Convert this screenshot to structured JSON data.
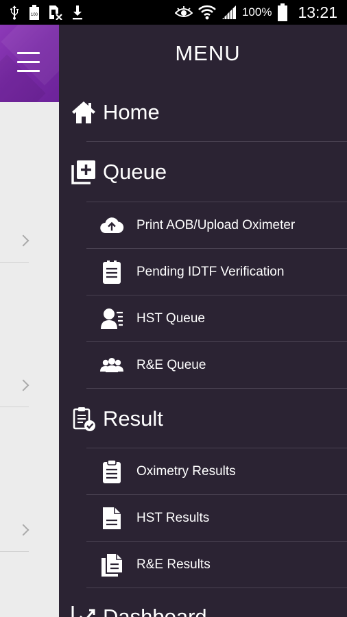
{
  "status_bar": {
    "icons": [
      "usb-icon",
      "battery-100-icon",
      "sim-error-icon",
      "download-icon",
      "eye-icon",
      "wifi-icon",
      "signal-icon",
      "battery-icon"
    ],
    "battery_percent": "100%",
    "time": "13:21"
  },
  "background_app": {
    "menu_icon": "hamburger-icon",
    "accent_color": "#7a2aa6"
  },
  "drawer": {
    "title": "MENU",
    "background_color": "#2b2333",
    "sections": {
      "home": {
        "label": "Home",
        "icon": "home-icon"
      },
      "queue": {
        "label": "Queue",
        "icon": "add-queue-icon"
      },
      "result": {
        "label": "Result",
        "icon": "clipboard-check-icon"
      },
      "dashboard": {
        "label": "Dashboard",
        "icon": "chart-icon"
      }
    },
    "queue_items": [
      {
        "label": "Print AOB/Upload Oximeter",
        "icon": "cloud-upload-icon"
      },
      {
        "label": "Pending IDTF Verification",
        "icon": "document-list-icon"
      },
      {
        "label": "HST Queue",
        "icon": "person-list-icon"
      },
      {
        "label": "R&E Queue",
        "icon": "group-icon"
      }
    ],
    "result_items": [
      {
        "label": "Oximetry Results",
        "icon": "clipboard-icon"
      },
      {
        "label": "HST Results",
        "icon": "file-icon"
      },
      {
        "label": "R&E Results",
        "icon": "files-icon"
      }
    ]
  }
}
